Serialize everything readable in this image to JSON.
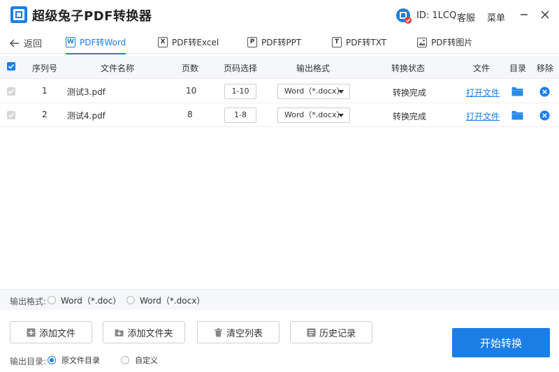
{
  "app": {
    "title": "超级兔子PDF转换器",
    "user_id": "ID: 1LCQ",
    "service": "客服",
    "menu": "菜单"
  },
  "nav": {
    "back_label": "返回",
    "tabs": [
      {
        "label": "PDF转Word",
        "icon": "W",
        "active": true
      },
      {
        "label": "PDF转Excel",
        "icon": "X",
        "active": false
      },
      {
        "label": "PDF转PPT",
        "icon": "P",
        "active": false
      },
      {
        "label": "PDF转TXT",
        "icon": "T",
        "active": false
      },
      {
        "label": "PDF转图片",
        "icon": "image-icon",
        "active": false
      }
    ]
  },
  "table": {
    "headers": {
      "index": "序列号",
      "name": "文件名称",
      "pages": "页数",
      "page_select": "页码选择",
      "format": "输出格式",
      "status": "转换状态",
      "file": "文件",
      "folder": "目录",
      "remove": "移除"
    },
    "rows": [
      {
        "index": "1",
        "name": "测试3.pdf",
        "pages": "10",
        "page_select": "1-10",
        "format": "Word（*.docx）",
        "status": "转换完成",
        "file_link": "打开文件"
      },
      {
        "index": "2",
        "name": "测试4.pdf",
        "pages": "8",
        "page_select": "1-8",
        "format": "Word（*.docx）",
        "status": "转换完成",
        "file_link": "打开文件"
      }
    ]
  },
  "output_format": {
    "label": "输出格式:",
    "options": [
      "Word（*.doc）",
      "Word（*.docx）"
    ]
  },
  "buttons": {
    "add_file": "添加文件",
    "add_folder": "添加文件夹",
    "clear_list": "清空列表",
    "history": "历史记录",
    "start": "开始转换"
  },
  "output_dir": {
    "label": "输出目录:",
    "options": [
      "原文件目录",
      "自定义"
    ],
    "selected": "原文件目录"
  },
  "colors": {
    "accent": "#1a7ee6",
    "header_bg": "#f5f7fa",
    "folder": "#2a8ae8",
    "remove": "#1a7ee6"
  }
}
